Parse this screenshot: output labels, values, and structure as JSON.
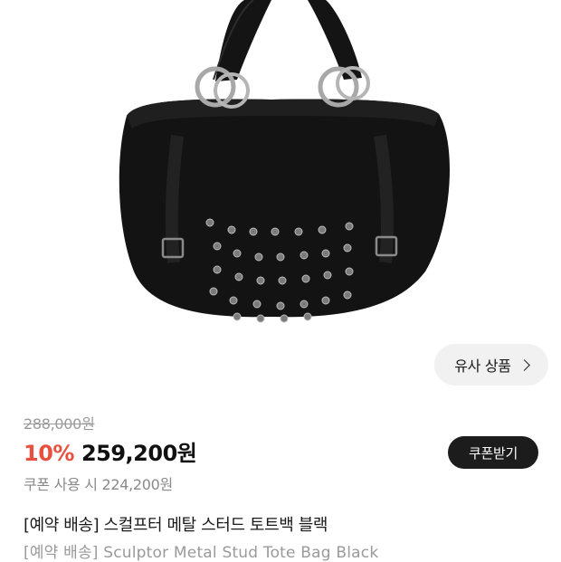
{
  "product": {
    "image_alt": "black leather stud tote bag",
    "original_price": "288,000원",
    "discount": "10%",
    "sale_price": "259,200원",
    "coupon_price": "쿠폰 사용 시 224,200원",
    "title_kr": "[예약 배송] 스컬프터 메탈 스터드 토트백 블랙",
    "title_en": "[예약 배송] Sculptor Metal Stud Tote Bag Black"
  },
  "buttons": {
    "similar_label": "유사 상품",
    "coupon_label": "쿠폰받기"
  },
  "colors": {
    "discount": "#e8513f",
    "coupon_button_bg": "#1c1c1c",
    "similar_button_bg": "#f1f1f1"
  }
}
